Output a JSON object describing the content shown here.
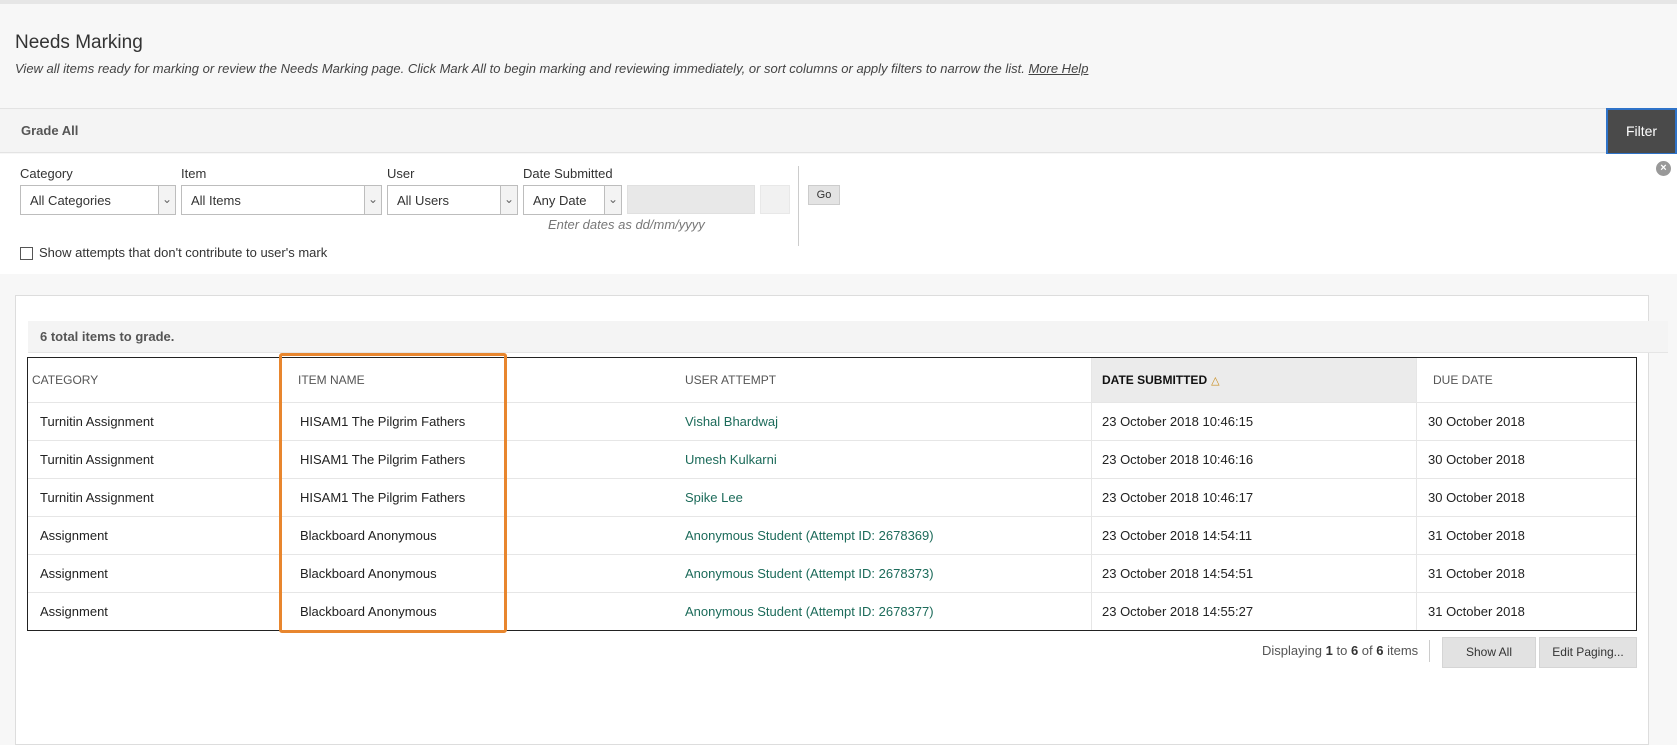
{
  "page": {
    "title": "Needs Marking",
    "description": "View all items ready for marking or review the Needs Marking page. Click Mark All to begin marking and reviewing immediately, or sort columns or apply filters to narrow the list.",
    "help_link": "More Help"
  },
  "actionbar": {
    "grade_all": "Grade All",
    "filter": "Filter"
  },
  "filters": {
    "category_label": "Category",
    "category_value": "All Categories",
    "item_label": "Item",
    "item_value": "All Items",
    "user_label": "User",
    "user_value": "All Users",
    "date_label": "Date Submitted",
    "date_value": "Any Date",
    "date_hint": "Enter dates as dd/mm/yyyy",
    "go": "Go",
    "show_attempts": "Show attempts that don't contribute to user's mark"
  },
  "grid": {
    "total": "6 total items to grade.",
    "headers": {
      "category": "CATEGORY",
      "item_name": "ITEM NAME",
      "user_attempt": "USER ATTEMPT",
      "date_submitted": "DATE SUBMITTED",
      "due_date": "DUE DATE"
    },
    "rows": [
      {
        "category": "Turnitin Assignment",
        "item": "HISAM1 The Pilgrim Fathers",
        "user": "Vishal Bhardwaj",
        "submitted": "23 October 2018 10:46:15",
        "due": "30 October 2018"
      },
      {
        "category": "Turnitin Assignment",
        "item": "HISAM1 The Pilgrim Fathers",
        "user": "Umesh Kulkarni",
        "submitted": "23 October 2018 10:46:16",
        "due": "30 October 2018"
      },
      {
        "category": "Turnitin Assignment",
        "item": "HISAM1 The Pilgrim Fathers",
        "user": "Spike Lee",
        "submitted": "23 October 2018 10:46:17",
        "due": "30 October 2018"
      },
      {
        "category": "Assignment",
        "item": "Blackboard Anonymous",
        "user": "Anonymous Student (Attempt ID: 2678369)",
        "submitted": "23 October 2018 14:54:11",
        "due": "31 October 2018"
      },
      {
        "category": "Assignment",
        "item": "Blackboard Anonymous",
        "user": "Anonymous Student (Attempt ID: 2678373)",
        "submitted": "23 October 2018 14:54:51",
        "due": "31 October 2018"
      },
      {
        "category": "Assignment",
        "item": "Blackboard Anonymous",
        "user": "Anonymous Student (Attempt ID: 2678377)",
        "submitted": "23 October 2018 14:55:27",
        "due": "31 October 2018"
      }
    ]
  },
  "paging": {
    "prefix": "Displaying",
    "from": "1",
    "to_word": "to",
    "to": "6",
    "of_word": "of",
    "total": "6",
    "suffix": "items",
    "show_all": "Show All",
    "edit_paging": "Edit Paging..."
  }
}
